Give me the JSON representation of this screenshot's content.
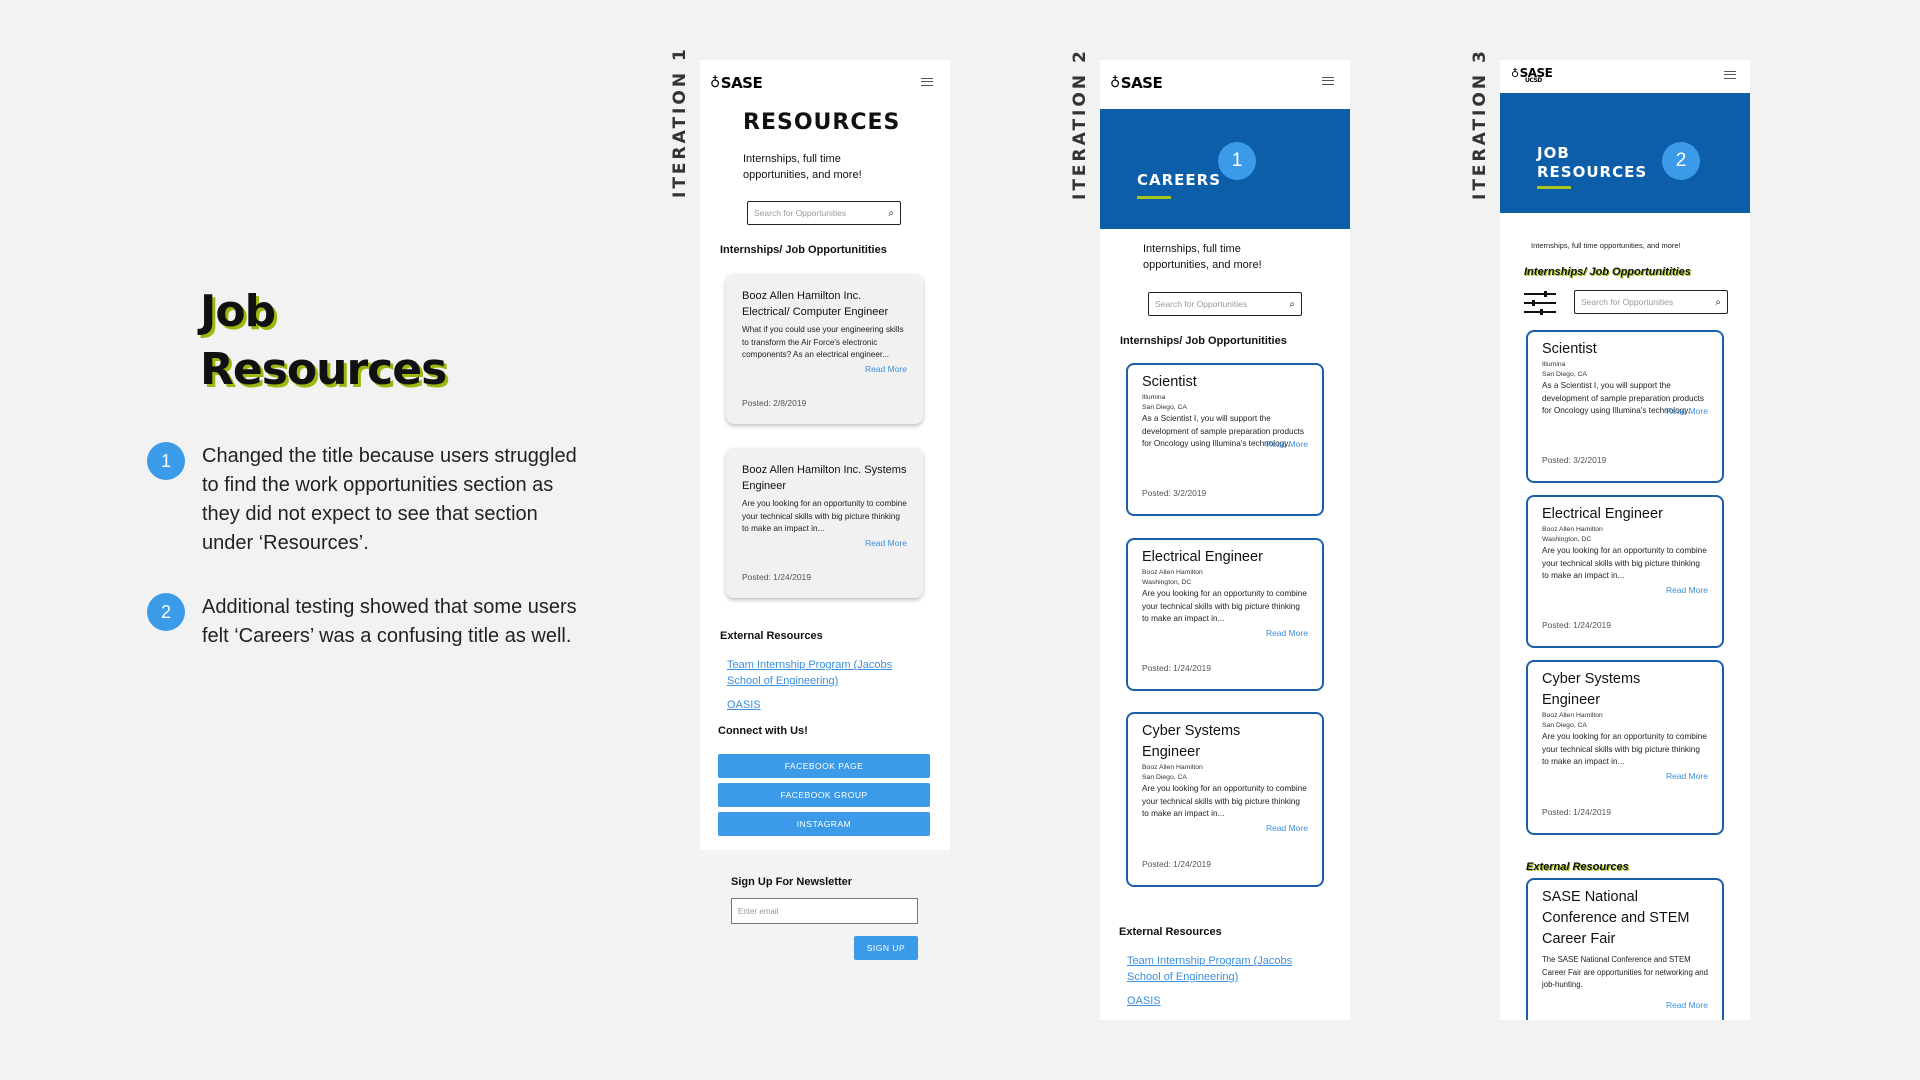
{
  "slide": {
    "heading_line1": "Job",
    "heading_line2": "Resources",
    "notes": [
      {
        "num": "1",
        "text": "Changed the title because users struggled to find the work opportunities section as they did not expect to see that section under ‘Resources’."
      },
      {
        "num": "2",
        "text": "Additional testing showed that some users felt ‘Careers’ was a confusing title as well."
      }
    ]
  },
  "iter1": {
    "label": "ITERATION 1",
    "logo": "SASE",
    "title": "RESOURCES",
    "subtitle": "Internships, full time opportunities, and more!",
    "search_placeholder": "Search for Opportunities",
    "section_title": "Internships/ Job Opportunitities",
    "cards": [
      {
        "title": "Booz Allen Hamilton Inc. Electrical/ Computer Engineer",
        "desc": "What if you could use your engineering skills to transform the Air Force's electronic components? As an electrical engineer...",
        "read_more": "Read More",
        "posted": "Posted: 2/8/2019"
      },
      {
        "title": "Booz Allen Hamilton Inc. Systems Engineer",
        "desc": "Are you looking for an opportunity to combine your technical skills with big picture thinking to make an impact in...",
        "read_more": "Read More",
        "posted": "Posted: 1/24/2019"
      }
    ],
    "external_title": "External Resources",
    "links": [
      "Team Internship Program (Jacobs School of Engineering)",
      "OASIS"
    ],
    "connect_title": "Connect with Us!",
    "buttons": [
      "FACEBOOK PAGE",
      "FACEBOOK GROUP",
      "INSTAGRAM"
    ],
    "newsletter_title": "Sign Up For Newsletter",
    "email_placeholder": "Enter email",
    "signup": "SIGN UP"
  },
  "iter2": {
    "label": "ITERATION 2",
    "logo": "SASE",
    "banner_title": "CAREERS",
    "badge": "1",
    "subtitle": "Internships, full time opportunities, and more!",
    "search_placeholder": "Search for Opportunities",
    "section_title": "Internships/ Job Opportunitities",
    "cards": [
      {
        "title": "Scientist",
        "company": "Illumina",
        "location": "San Diego, CA",
        "desc": "As a Scientist I, you will support the development of sample preparation products for Oncology using Illumina's technology.",
        "read_more": "Read More",
        "posted": "Posted: 3/2/2019"
      },
      {
        "title": "Electrical Engineer",
        "company": "Booz Allen Hamilton",
        "location": "Washington, DC",
        "desc": "Are you looking for an opportunity to combine your technical skills with big picture thinking to make an impact in...",
        "read_more": "Read More",
        "posted": "Posted: 1/24/2019"
      },
      {
        "title": "Cyber Systems Engineer",
        "company": "Booz Allen Hamilton",
        "location": "San Diego, CA",
        "desc": "Are you looking for an opportunity to combine your technical skills with big picture thinking to make an impact in...",
        "read_more": "Read More",
        "posted": "Posted: 1/24/2019"
      }
    ],
    "external_title": "External Resources",
    "links": [
      "Team Internship Program (Jacobs School of Engineering)",
      "OASIS"
    ]
  },
  "iter3": {
    "label": "ITERATION 3",
    "logo": "SASE",
    "logo_sub": "UCSD",
    "banner_title_1": "JOB",
    "banner_title_2": "RESOURCES",
    "badge": "2",
    "subtitle": "Internships, full time opportunities, and more!",
    "section_title": "Internships/ Job Opportunitities",
    "search_placeholder": "Search for Opportunities",
    "cards": [
      {
        "title": "Scientist",
        "company": "Illumina",
        "location": "San Diego, CA",
        "desc": "As a Scientist I, you will support the development of sample preparation products for Oncology using Illumina's technology.",
        "read_more": "Read More",
        "posted": "Posted: 3/2/2019"
      },
      {
        "title": "Electrical Engineer",
        "company": "Booz Allen Hamilton",
        "location": "Washington, DC",
        "desc": "Are you looking for an opportunity to combine your technical skills with big picture thinking to make an impact in...",
        "read_more": "Read More",
        "posted": "Posted: 1/24/2019"
      },
      {
        "title": "Cyber Systems Engineer",
        "company": "Booz Allen Hamilton",
        "location": "San Diego, CA",
        "desc": "Are you looking for an opportunity to combine your technical skills with big picture thinking to make an impact in...",
        "read_more": "Read More",
        "posted": "Posted: 1/24/2019"
      }
    ],
    "external_title": "External Resources",
    "ext_card": {
      "title": "SASE National Conference and STEM Career Fair",
      "desc": "The SASE National Conference and STEM Career Fair are opportunities for networking and job-hunting.",
      "read_more": "Read More"
    }
  },
  "colors": {
    "accent_blue": "#3b9be8",
    "banner_blue": "#0d5ea9",
    "highlight_green": "#9bb80f"
  }
}
